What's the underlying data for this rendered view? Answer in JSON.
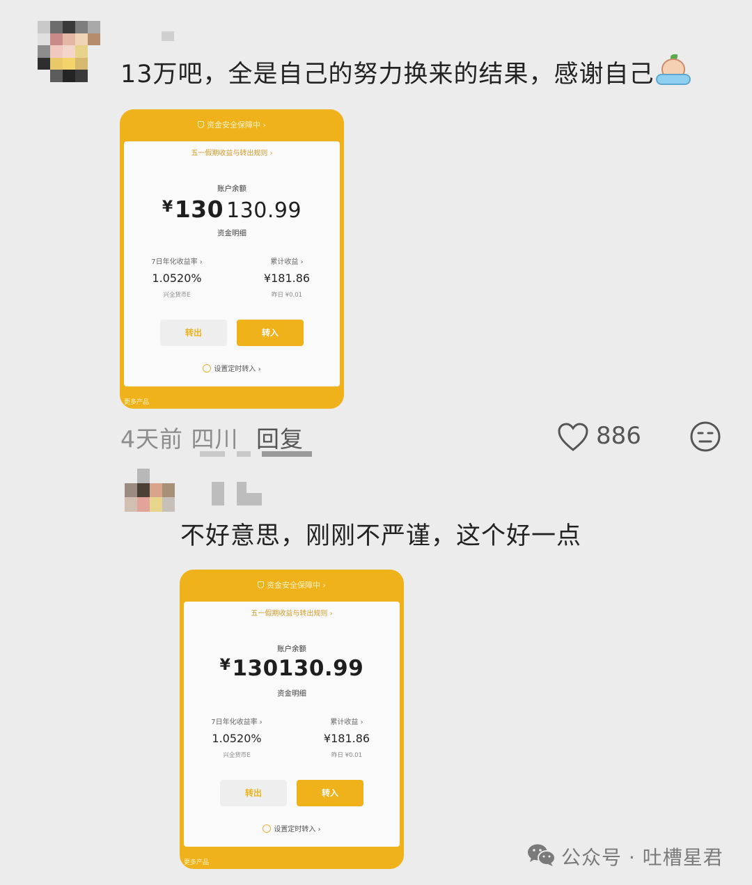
{
  "colors": {
    "accent": "#f0b21b",
    "background": "#ececec"
  },
  "comment1": {
    "text": "13万吧，全是自己的努力换来的结果，感谢自己",
    "emoji": "crying-in-blanket-emoji",
    "time": "4天前",
    "location": "四川",
    "reply_label": "回复",
    "like_count": "886"
  },
  "screenshot1": {
    "security": "资金安全保障中 ›",
    "rule_link": "五一假期收益与转出规则 ›",
    "balance_label": "账户余额",
    "currency": "¥",
    "balance_part1": "130",
    "balance_part2": "130.99",
    "detail_link": "资金明细",
    "yield_label": "7日年化收益率 ›",
    "yield_value": "1.0520%",
    "fund_name": "兴全货币E",
    "earnings_label": "累计收益 ›",
    "earnings_value": "¥181.86",
    "yesterday": "昨日 ¥0.01",
    "btn_out": "转出",
    "btn_in": "转入",
    "timer_link": "设置定时转入 ›",
    "more_products": "更多产品"
  },
  "comment2": {
    "text": "不好意思，刚刚不严谨，这个好一点"
  },
  "screenshot2": {
    "security": "资金安全保障中 ›",
    "rule_link": "五一假期收益与转出规则 ›",
    "balance_label": "账户余额",
    "currency": "¥",
    "balance": "130130.99",
    "detail_link": "资金明细",
    "yield_label": "7日年化收益率 ›",
    "yield_value": "1.0520%",
    "fund_name": "兴全货币E",
    "earnings_label": "累计收益 ›",
    "earnings_value": "¥181.86",
    "yesterday": "昨日 ¥0.01",
    "btn_out": "转出",
    "btn_in": "转入",
    "timer_link": "设置定时转入 ›",
    "more_products": "更多产品"
  },
  "watermark": {
    "icon": "wechat-icon",
    "text": "公众号 · 吐槽星君"
  }
}
